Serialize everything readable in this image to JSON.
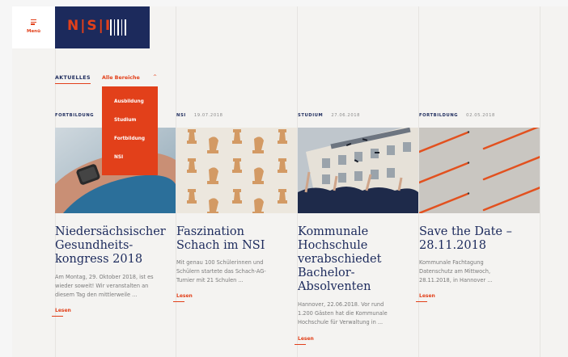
{
  "menu": {
    "label": "Menü"
  },
  "logo": {
    "text": "N|S|I"
  },
  "filter": {
    "tab_label": "AKTUELLES",
    "dropdown_label": "Alle Bereiche",
    "options": [
      "Ausbildung",
      "Studium",
      "Fortbildung",
      "NSI"
    ]
  },
  "articles": [
    {
      "category": "FORTBILDUNG",
      "date": "",
      "title_lines": [
        "Niedersächsischer",
        "Gesundheits-",
        "kongress 2018"
      ],
      "excerpt_lines": [
        "Am Montag, 29. Oktober 2018, ist es",
        "wieder soweit! Wir veranstalten an",
        "diesem Tag den mittlerweile ..."
      ],
      "link": "Lesen"
    },
    {
      "category": "NSI",
      "date": "19.07.2018",
      "title_lines": [
        "Faszination",
        "Schach im NSI"
      ],
      "excerpt_lines": [
        "Mit genau 100 Schülerinnen und",
        "Schülern startete das Schach-AG-",
        "Turnier mit 21 Schulen ..."
      ],
      "link": "Lesen"
    },
    {
      "category": "STUDIUM",
      "date": "27.06.2018",
      "title_lines": [
        "Kommunale",
        "Hochschule",
        "verabschiedet",
        "Bachelor-",
        "Absolventen"
      ],
      "excerpt_lines": [
        "Hannover, 22.06.2018. Vor rund",
        "1.200 Gästen hat die Kommunale",
        "Hochschule für Verwaltung in ..."
      ],
      "link": "Lesen"
    },
    {
      "category": "FORTBILDUNG",
      "date": "02.05.2018",
      "title_lines": [
        "Save the Date –",
        "28.11.2018"
      ],
      "excerpt_lines": [
        "Kommunale Fachtagung",
        "Datenschutz am Mittwoch,",
        "28.11.2018, in Hannover ..."
      ],
      "link": "Lesen"
    }
  ],
  "colors": {
    "accent": "#e2401a",
    "navy": "#1c2a5c",
    "background": "#f4f3f1"
  }
}
